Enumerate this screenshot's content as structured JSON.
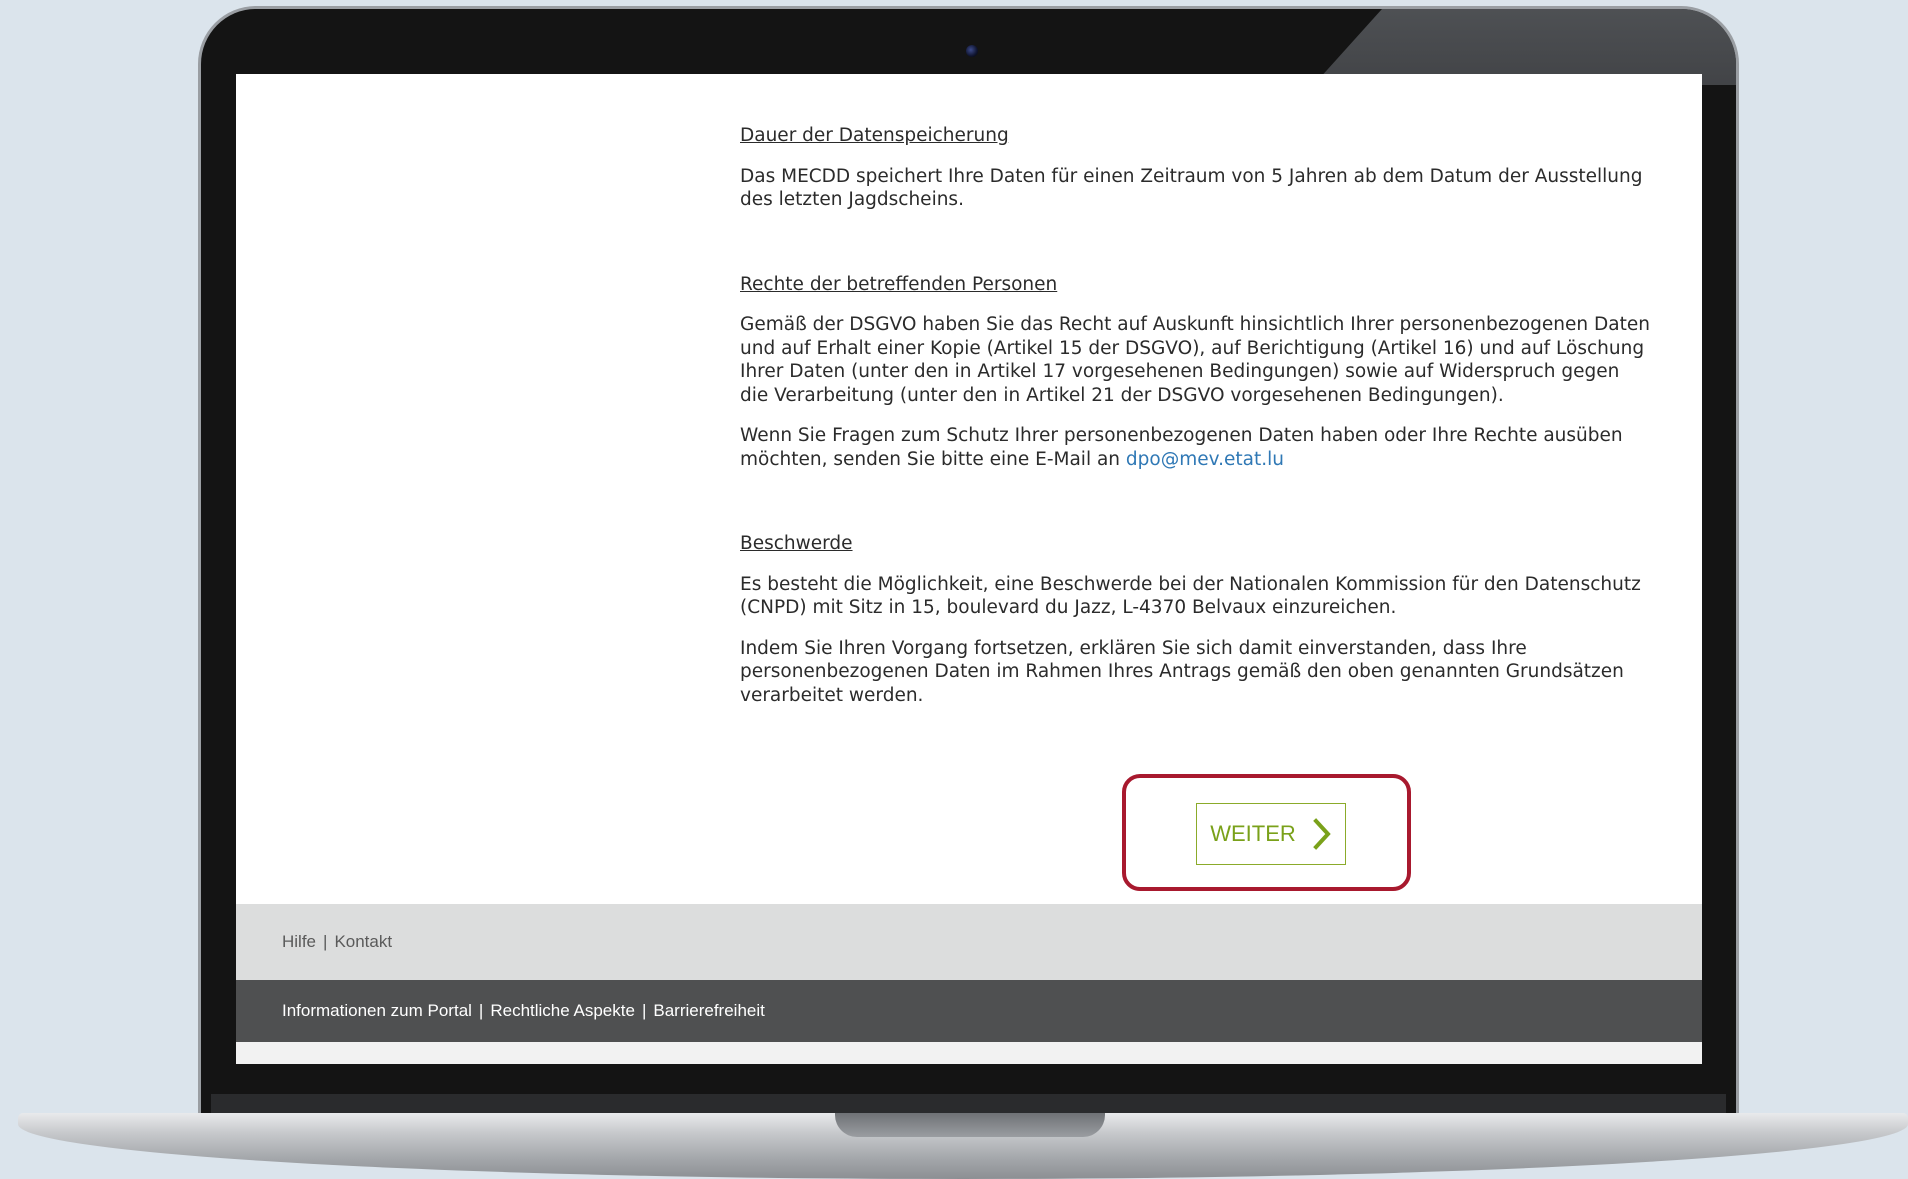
{
  "sections": [
    {
      "title": "Dauer der Datenspeicherung",
      "paragraphs": [
        "Das MECDD speichert Ihre Daten für einen Zeitraum von 5 Jahren ab dem Datum der Ausstellung des letzten Jagdscheins."
      ]
    },
    {
      "title": "Rechte der betreffenden Personen",
      "paragraphs": [
        "Gemäß der DSGVO haben Sie das Recht auf Auskunft hinsichtlich Ihrer personenbezogenen Daten und auf Erhalt einer Kopie (Artikel 15 der DSGVO), auf Berichtigung (Artikel 16) und auf Löschung Ihrer Daten (unter den in Artikel 17 vorgesehenen Bedingungen) sowie auf Widerspruch gegen die Verarbeitung (unter den in Artikel 21 der DSGVO vorgesehenen Bedingungen)."
      ],
      "contact_text": "Wenn Sie Fragen zum Schutz Ihrer personenbezogenen Daten haben oder Ihre Rechte ausüben möchten, senden Sie bitte eine E-Mail an ",
      "contact_email": "dpo@mev.etat.lu"
    },
    {
      "title": "Beschwerde",
      "paragraphs": [
        "Es besteht die Möglichkeit, eine Beschwerde bei der Nationalen Kommission für den Datenschutz (CNPD) mit Sitz in 15, boulevard du Jazz, L-4370 Belvaux einzureichen.",
        "Indem Sie Ihren Vorgang fortsetzen, erklären Sie sich damit einverstanden, dass Ihre personenbezogenen Daten im Rahmen Ihres Antrags gemäß den oben genannten Grundsätzen verarbeitet werden."
      ]
    }
  ],
  "button": {
    "label": "WEITER",
    "icon": "chevron-right-icon"
  },
  "footer_light": {
    "links": [
      "Hilfe",
      "Kontakt"
    ],
    "separator": "|"
  },
  "footer_dark": {
    "links": [
      "Informationen zum Portal",
      "Rechtliche Aspekte",
      "Barrierefreiheit"
    ],
    "separator": "|"
  },
  "colors": {
    "accent_green": "#7aa11a",
    "highlight_red": "#a8192e",
    "link_blue": "#2f78b5",
    "footer_dark": "#4f5051",
    "footer_light": "#dcdddd"
  }
}
